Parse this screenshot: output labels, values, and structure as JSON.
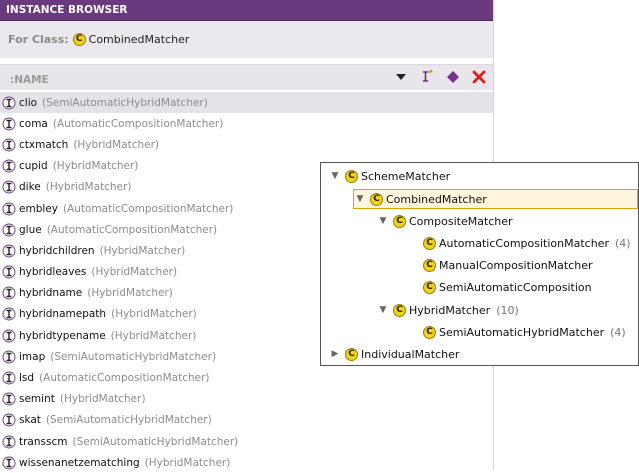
{
  "browser": {
    "title": "INSTANCE BROWSER",
    "for_class_label": "For Class:",
    "for_class_value": "CombinedMatcher",
    "column_header": ":NAME",
    "class_icon_letter": "C",
    "instances": [
      {
        "name": "clio",
        "cls": "(SemiAutomaticHybridMatcher)"
      },
      {
        "name": "coma",
        "cls": "(AutomaticCompositionMatcher)"
      },
      {
        "name": "ctxmatch",
        "cls": "(HybridMatcher)"
      },
      {
        "name": "cupid",
        "cls": "(HybridMatcher)"
      },
      {
        "name": "dike",
        "cls": "(HybridMatcher)"
      },
      {
        "name": "embley",
        "cls": "(AutomaticCompositionMatcher)"
      },
      {
        "name": "glue",
        "cls": "(AutomaticCompositionMatcher)"
      },
      {
        "name": "hybridchildren",
        "cls": "(HybridMatcher)"
      },
      {
        "name": "hybridleaves",
        "cls": "(HybridMatcher)"
      },
      {
        "name": "hybridname",
        "cls": "(HybridMatcher)"
      },
      {
        "name": "hybridnamepath",
        "cls": "(HybridMatcher)"
      },
      {
        "name": "hybridtypename",
        "cls": "(HybridMatcher)"
      },
      {
        "name": "imap",
        "cls": "(SemiAutomaticHybridMatcher)"
      },
      {
        "name": "lsd",
        "cls": "(AutomaticCompositionMatcher)"
      },
      {
        "name": "semint",
        "cls": "(HybridMatcher)"
      },
      {
        "name": "skat",
        "cls": "(SemiAutomaticHybridMatcher)"
      },
      {
        "name": "transscm",
        "cls": "(SemiAutomaticHybridMatcher)"
      },
      {
        "name": "wissenanetzematching",
        "cls": "(HybridMatcher)"
      }
    ],
    "colors": {
      "title_bg": "#6b3a7e",
      "delete": "#d9201c",
      "diamond": "#7a2f8a",
      "class_icon": "#f2d11c"
    }
  },
  "tree": {
    "nodes": [
      {
        "label": "SchemeMatcher",
        "count": "",
        "toggle": "▼"
      },
      {
        "label": "CombinedMatcher",
        "count": "",
        "toggle": "▼"
      },
      {
        "label": "CompositeMatcher",
        "count": "",
        "toggle": "▼"
      },
      {
        "label": "AutomaticCompositionMatcher",
        "count": "(4)",
        "toggle": ""
      },
      {
        "label": "ManualCompositionMatcher",
        "count": "",
        "toggle": ""
      },
      {
        "label": "SemiAutomaticComposition",
        "count": "",
        "toggle": ""
      },
      {
        "label": "HybridMatcher",
        "count": "(10)",
        "toggle": "▼"
      },
      {
        "label": "SemiAutomaticHybridMatcher",
        "count": "(4)",
        "toggle": ""
      },
      {
        "label": "IndividualMatcher",
        "count": "",
        "toggle": "▶"
      }
    ]
  }
}
